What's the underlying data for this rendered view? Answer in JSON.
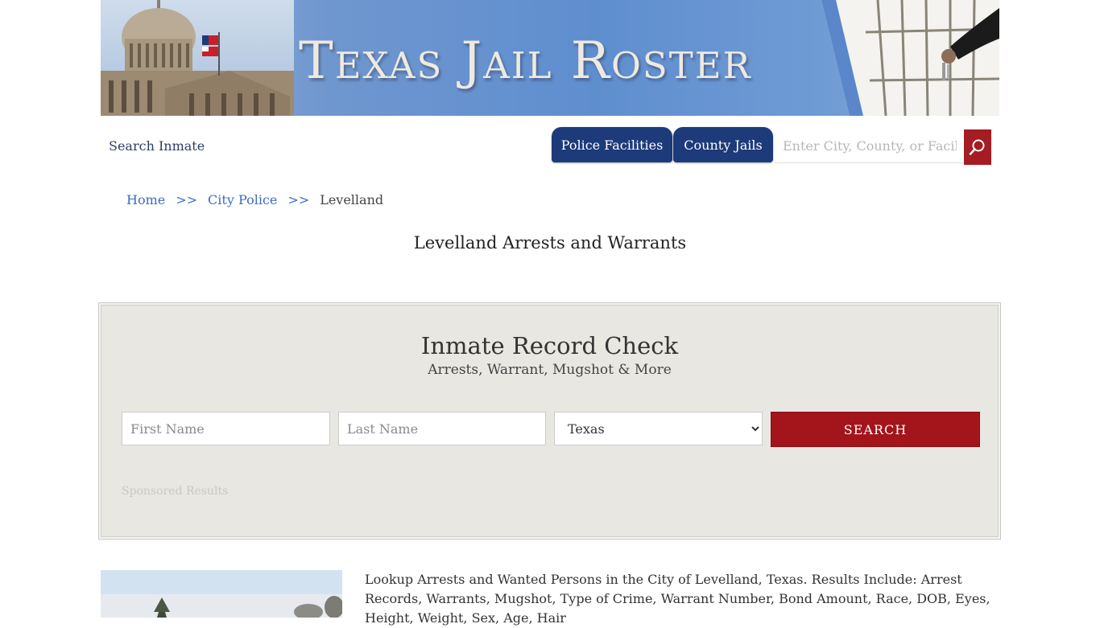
{
  "banner": {
    "title": "Texas Jail Roster"
  },
  "nav": {
    "search_inmate": "Search Inmate",
    "tabs": [
      {
        "label": "Police Facilities"
      },
      {
        "label": "County Jails"
      }
    ],
    "search": {
      "placeholder": "Enter City, County, or Facility",
      "icon": "magnifier-icon"
    }
  },
  "breadcrumb": {
    "home": "Home",
    "separator": ">>",
    "city_police": "City Police",
    "current": "Levelland"
  },
  "page": {
    "title": "Levelland Arrests and Warrants"
  },
  "record_check": {
    "title": "Inmate Record Check",
    "subtitle": "Arrests, Warrant, Mugshot & More",
    "first_name_placeholder": "First Name",
    "last_name_placeholder": "Last Name",
    "state_selected": "Texas",
    "search_label": "SEARCH",
    "sponsored": "Sponsored Results"
  },
  "content": {
    "description": "Lookup Arrests and Wanted Persons in the City of Levelland, Texas. Results Include: Arrest Records, Warrants, Mugshot, Type of Crime, Warrant Number, Bond Amount, Race, DOB, Eyes, Height, Weight, Sex, Age, Hair"
  },
  "colors": {
    "nav_blue": "#1d3b7a",
    "accent_red": "#a3141b",
    "link_blue": "#3b6cc5",
    "panel_bg": "#e8e7e2"
  }
}
